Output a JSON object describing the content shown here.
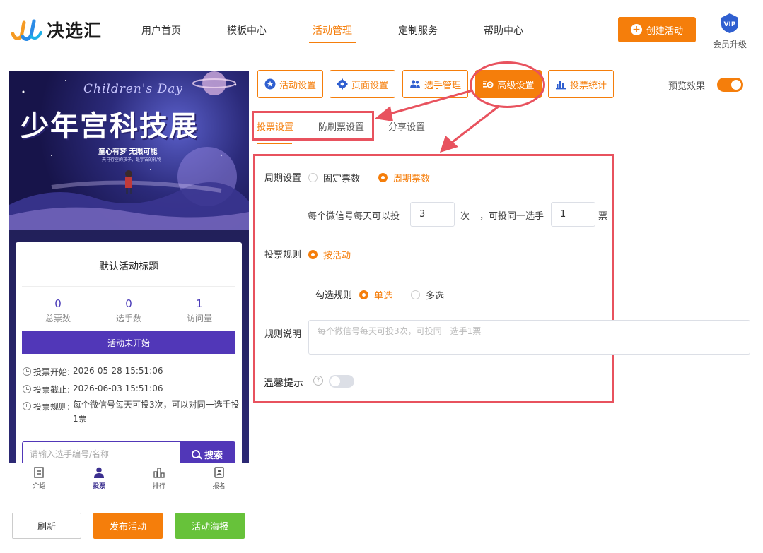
{
  "brand": {
    "name": "决选汇"
  },
  "nav": {
    "items": [
      "用户首页",
      "模板中心",
      "活动管理",
      "定制服务",
      "帮助中心"
    ],
    "active_index": 2
  },
  "header": {
    "create_label": "创建活动",
    "vip_badge": "VIP",
    "vip_label": "会员升级"
  },
  "banner": {
    "subtitle": "Children's Day",
    "title": "少年宫科技展",
    "slogan": "童心有梦 无限可能",
    "slogan_small": "天马行空的孩子，是宇宙的礼物"
  },
  "card": {
    "title": "默认活动标题",
    "stats": [
      {
        "value": "0",
        "label": "总票数"
      },
      {
        "value": "0",
        "label": "选手数"
      },
      {
        "value": "1",
        "label": "访问量"
      }
    ],
    "status": "活动未开始",
    "vote_start_label": "投票开始:",
    "vote_start": "2026-05-28 15:51:06",
    "vote_end_label": "投票截止:",
    "vote_end": "2026-06-03 15:51:06",
    "rule_label": "投票规则:",
    "rule_text": "每个微信号每天可投3次，可以对同一选手投1票",
    "search_placeholder": "请输入选手编号/名称",
    "search_label": "搜索"
  },
  "tabbar": {
    "items": [
      "介绍",
      "投票",
      "排行",
      "报名"
    ],
    "active_index": 1
  },
  "bottom_buttons": {
    "refresh": "刷新",
    "publish": "发布活动",
    "poster": "活动海报"
  },
  "settings_tabs": {
    "items": [
      "活动设置",
      "页面设置",
      "选手管理",
      "高级设置",
      "投票统计"
    ],
    "active_index": 3
  },
  "preview": {
    "label": "预览效果",
    "enabled": true
  },
  "sub_tabs": {
    "items": [
      "投票设置",
      "防刷票设置",
      "分享设置"
    ],
    "active_index": 0
  },
  "form": {
    "cycle_label": "周期设置",
    "cycle_options": [
      "固定票数",
      "周期票数"
    ],
    "cycle_selected": 1,
    "per_day_prefix": "每个微信号每天可以投",
    "per_day_value": "3",
    "per_day_unit": "次",
    "same_prefix": "，可投同一选手",
    "same_value": "1",
    "same_unit": "票",
    "rule_label": "投票规则",
    "rule_option": "按活动",
    "select_rule_label": "勾选规则",
    "select_options": [
      "单选",
      "多选"
    ],
    "select_selected": 0,
    "desc_label": "规则说明",
    "desc_placeholder": "每个微信号每天可投3次，可投同一选手1票",
    "tip_label": "温馨提示",
    "tip_help": "?",
    "tip_enabled": false
  },
  "colors": {
    "accent": "#f57e0b",
    "purple": "#5137b8",
    "highlight": "#e8525e",
    "green": "#67c23a"
  }
}
